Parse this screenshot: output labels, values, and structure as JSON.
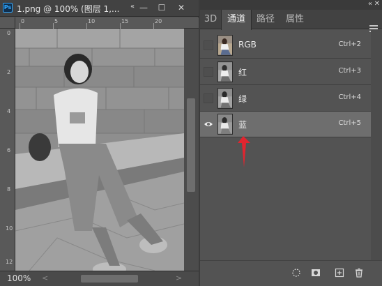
{
  "document": {
    "title": "1.png @ 100% (图层 1,...",
    "zoom": "100%",
    "app_icon": "Ps",
    "ruler_top": [
      "0",
      "5",
      "10",
      "15",
      "20"
    ],
    "ruler_left": [
      "0",
      "2",
      "4",
      "6",
      "8",
      "10",
      "12"
    ],
    "window_buttons": {
      "collapse": "«",
      "minimize": "—",
      "maximize": "☐",
      "close": "✕"
    },
    "hscroll": {
      "left": "<",
      "right": ">"
    }
  },
  "panel": {
    "collapse_icon": "«",
    "close_icon": "✕",
    "tabs": [
      {
        "label": "3D",
        "active": false
      },
      {
        "label": "通道",
        "active": true
      },
      {
        "label": "路径",
        "active": false
      },
      {
        "label": "属性",
        "active": false
      }
    ],
    "channels": [
      {
        "name": "RGB",
        "shortcut": "Ctrl+2",
        "visible": false,
        "active": false
      },
      {
        "name": "红",
        "shortcut": "Ctrl+3",
        "visible": false,
        "active": false
      },
      {
        "name": "绿",
        "shortcut": "Ctrl+4",
        "visible": false,
        "active": false
      },
      {
        "name": "蓝",
        "shortcut": "Ctrl+5",
        "visible": true,
        "active": true
      }
    ],
    "bottom_icons": [
      "load-selection-icon",
      "save-selection-icon",
      "new-channel-icon",
      "delete-channel-icon"
    ]
  },
  "colors": {
    "annotation_arrow": "#e0252f",
    "ps_blue": "#31a8ff"
  }
}
